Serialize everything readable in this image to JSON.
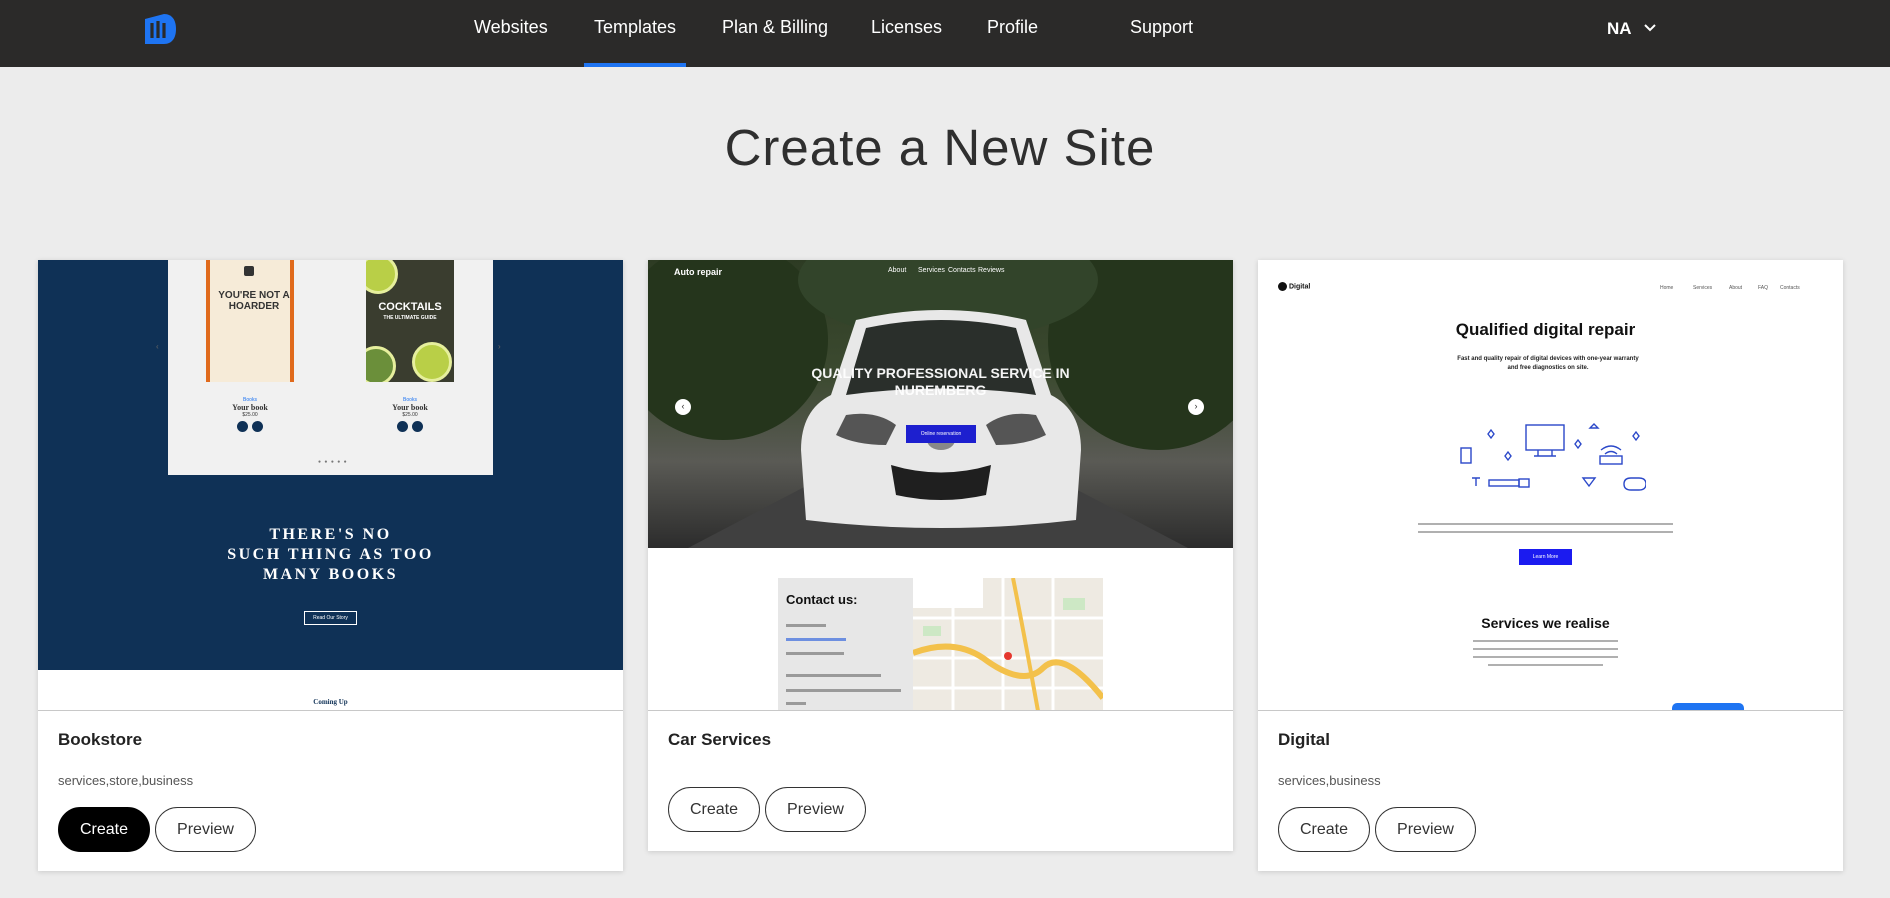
{
  "nav": {
    "items": [
      {
        "label": "Websites",
        "active": false
      },
      {
        "label": "Templates",
        "active": true
      },
      {
        "label": "Plan & Billing",
        "active": false
      },
      {
        "label": "Licenses",
        "active": false
      },
      {
        "label": "Profile",
        "active": false
      },
      {
        "label": "Support",
        "active": false
      }
    ],
    "user_initials": "NA",
    "accent_color": "#1e74f2",
    "bar_color": "#2b2a29"
  },
  "page": {
    "title": "Create a New Site"
  },
  "templates": [
    {
      "name": "Bookstore",
      "tags": "services,store,business",
      "create_label": "Create",
      "preview_label": "Preview",
      "create_primary": true,
      "thumb": {
        "book1_title": "YOU'RE NOT A HOARDER",
        "book2_title": "COCKTAILS",
        "book2_subtitle": "THE ULTIMATE GUIDE",
        "book_label_small": "Books",
        "book1_name": "Your book",
        "book2_name": "Your book",
        "book_price": "$25.00",
        "heading_line1": "THERE'S NO",
        "heading_line2": "SUCH THING AS TOO",
        "heading_line3": "MANY BOOKS",
        "button": "Read Our Story",
        "coming": "Coming Up"
      }
    },
    {
      "name": "Car Services",
      "tags": "",
      "create_label": "Create",
      "preview_label": "Preview",
      "create_primary": false,
      "thumb": {
        "brand": "Auto repair",
        "nav": [
          "About",
          "Services",
          "Contacts",
          "Reviews"
        ],
        "hero_line1": "QUALITY PROFESSIONAL SERVICE IN",
        "hero_line2": "NUREMBERG",
        "cta": "Online reservation",
        "contact_heading": "Contact us:"
      }
    },
    {
      "name": "Digital",
      "tags": "services,business",
      "create_label": "Create",
      "preview_label": "Preview",
      "create_primary": false,
      "thumb": {
        "brand": "Digital",
        "nav": [
          "Home",
          "Services",
          "About",
          "FAQ",
          "Contacts"
        ],
        "headline": "Qualified digital repair",
        "subline1": "Fast and quality repair of digital devices with one-year warranty",
        "subline2": "and free diagnostics on site.",
        "cta": "Learn More",
        "services_heading": "Services we realise"
      }
    }
  ]
}
